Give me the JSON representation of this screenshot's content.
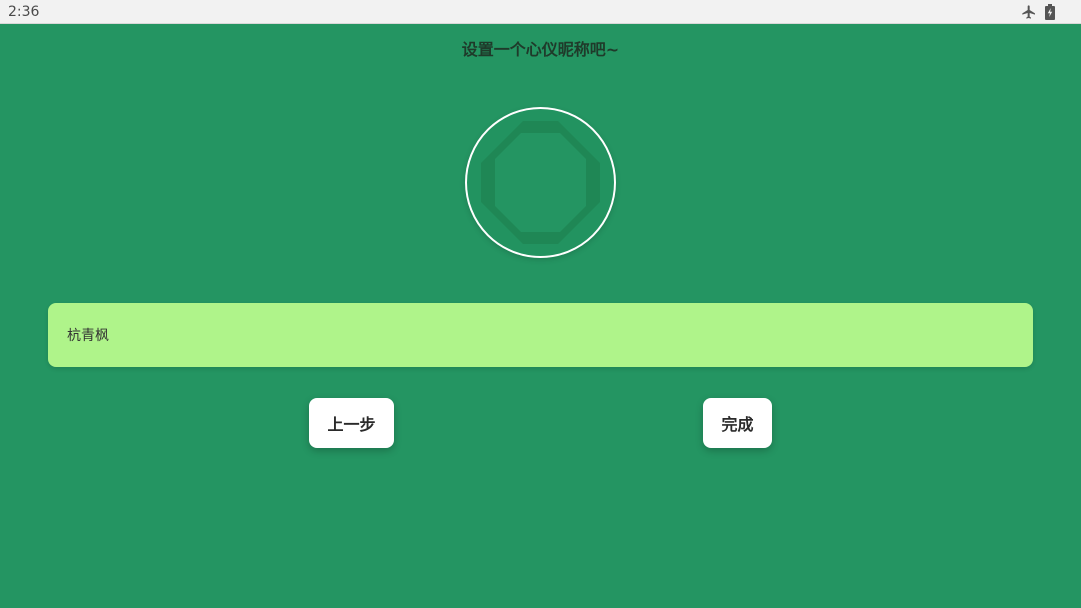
{
  "status_bar": {
    "time": "2:36",
    "icons": [
      "airplane-mode-icon",
      "battery-charging-icon"
    ]
  },
  "title": "设置一个心仪昵称吧~",
  "avatar": {
    "icon": "octagon-avatar-icon"
  },
  "nickname": {
    "value": "杭青枫"
  },
  "buttons": {
    "back_label": "上一步",
    "done_label": "完成"
  },
  "colors": {
    "background": "#249562",
    "input_background": "#aff48a",
    "button_background": "#ffffff",
    "avatar_inner": "#1f8755"
  }
}
